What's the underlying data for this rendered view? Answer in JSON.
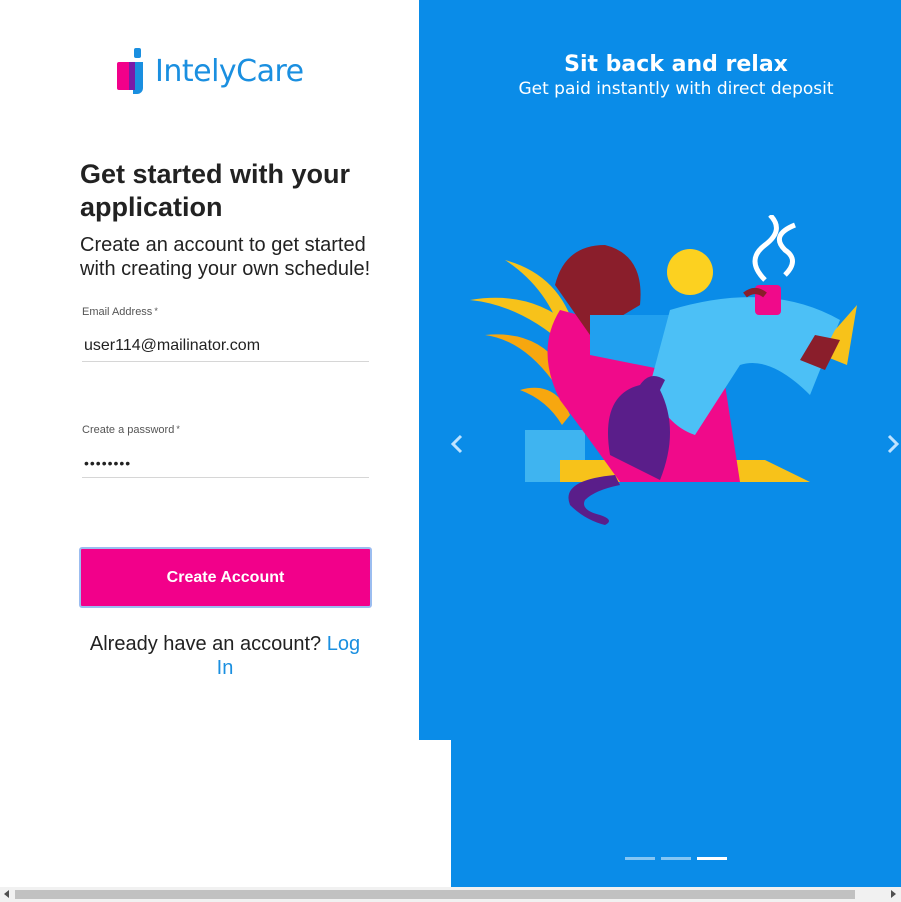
{
  "brand": {
    "name": "IntelyCare"
  },
  "form": {
    "heading": "Get started with your application",
    "subheading": "Create an account to get started with creating your own schedule!",
    "email": {
      "label": "Email Address",
      "required_mark": "*",
      "value": "user114@mailinator.com"
    },
    "password": {
      "label": "Create a password",
      "required_mark": "*",
      "value": "••••••••"
    },
    "submit_label": "Create Account",
    "login_prompt": "Already have an account?",
    "login_link": "Log In"
  },
  "carousel": {
    "title": "Sit back and relax",
    "subtitle": "Get paid instantly with direct deposit",
    "slide_count": 3,
    "active_slide": 3
  },
  "colors": {
    "accent_blue": "#0a8ce8",
    "brand_pink": "#f2008a",
    "link_blue": "#1a8fe0"
  }
}
